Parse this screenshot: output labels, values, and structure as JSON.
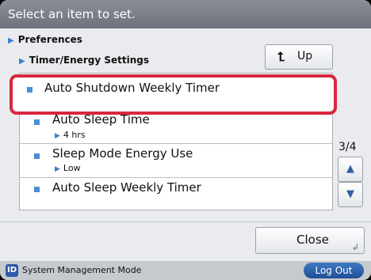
{
  "title": "Select an item to set.",
  "breadcrumb": {
    "level1": "Preferences",
    "level2": "Timer/Energy Settings"
  },
  "up_button": {
    "icon": "up-return-arrow-icon",
    "label": "Up"
  },
  "list": {
    "items": [
      {
        "label": "Auto Shutdown Weekly Timer",
        "value": "",
        "selected": true
      },
      {
        "label": "Auto Sleep Time",
        "value": "4 hrs",
        "selected": false
      },
      {
        "label": "Sleep Mode Energy Use",
        "value": "Low",
        "selected": false
      },
      {
        "label": "Auto Sleep Weekly Timer",
        "value": "",
        "selected": false
      }
    ]
  },
  "pager": {
    "indicator": "3/4",
    "up_icon": "triangle-up-icon",
    "down_icon": "triangle-down-icon"
  },
  "close_button": {
    "label": "Close"
  },
  "status_bar": {
    "mode_icon": "ID",
    "mode_text": "System Management Mode",
    "logout_label": "Log Out"
  },
  "colors": {
    "accent_blue": "#4a8fd6",
    "selection_red": "#d8283f",
    "logout_blue": "#2d59a9"
  }
}
